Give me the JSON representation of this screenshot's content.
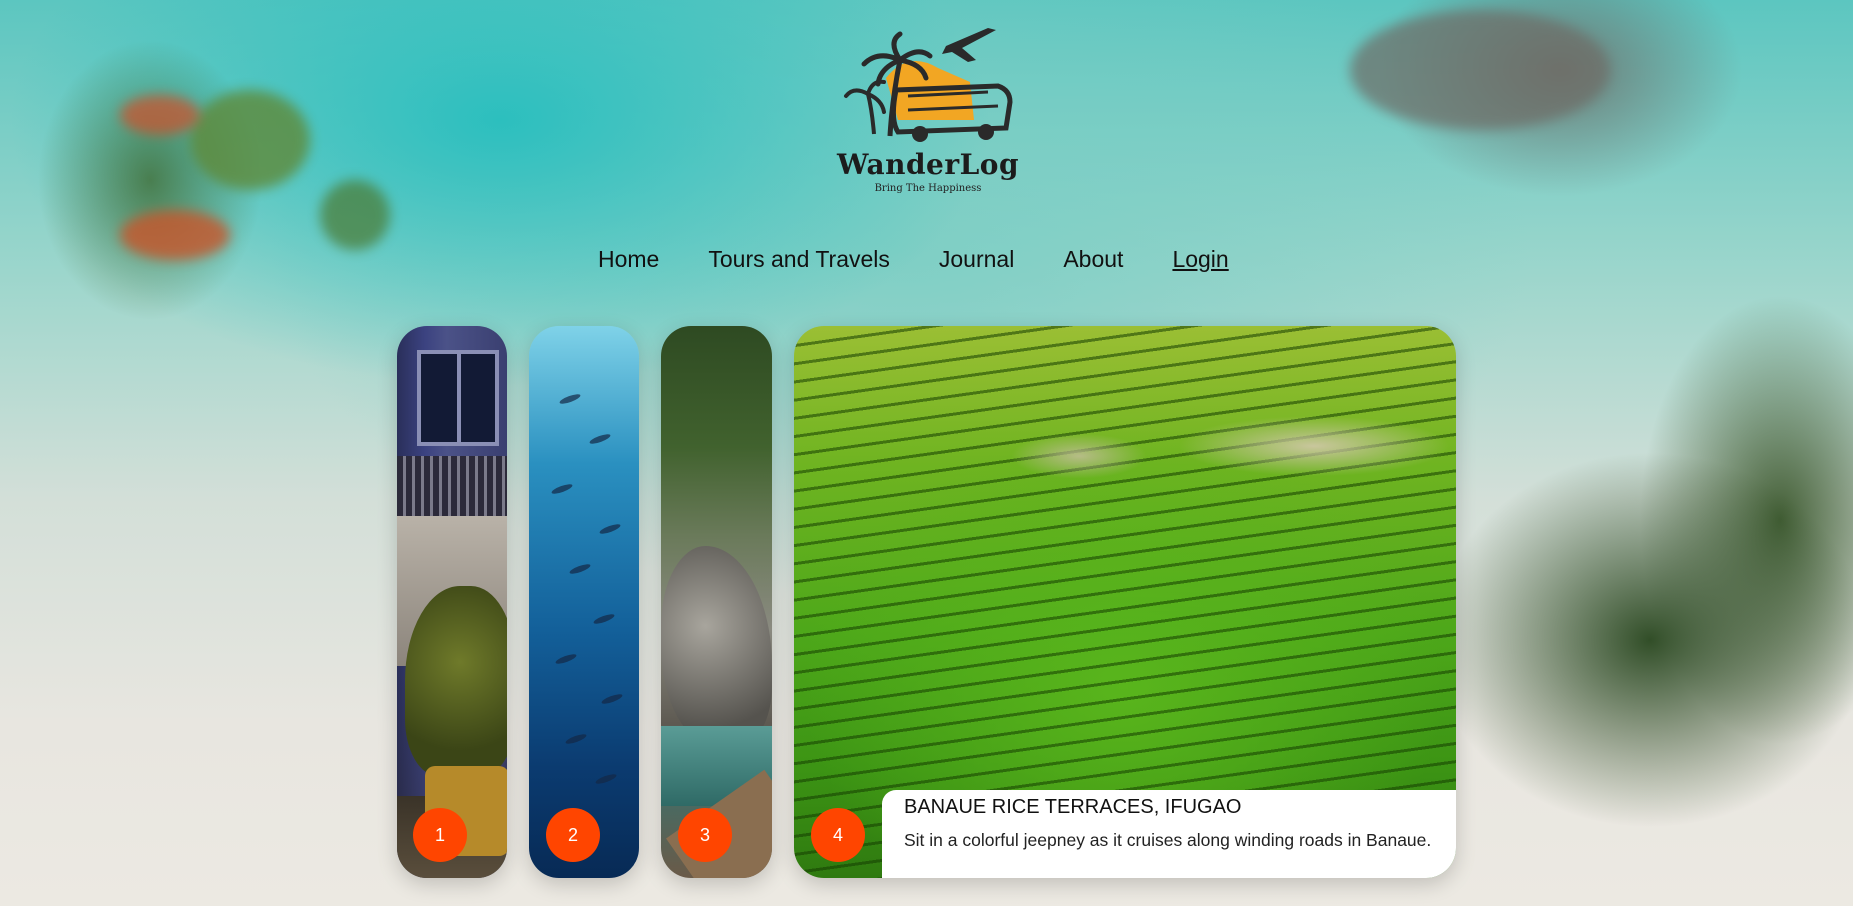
{
  "brand": {
    "name": "WanderLog",
    "tagline": "Bring The Happiness",
    "colors": {
      "accent": "#ff4500",
      "logo_orange": "#f2a623",
      "logo_dark": "#2a2a2a"
    }
  },
  "nav": {
    "items": [
      {
        "label": "Home"
      },
      {
        "label": "Tours and Travels"
      },
      {
        "label": "Journal"
      },
      {
        "label": "About"
      },
      {
        "label": "Login"
      }
    ]
  },
  "carousel": {
    "active_index": 4,
    "slides": [
      {
        "number": "1",
        "scene": "building-facade"
      },
      {
        "number": "2",
        "scene": "underwater-fish"
      },
      {
        "number": "3",
        "scene": "cave-lagoon"
      },
      {
        "number": "4",
        "scene": "rice-terraces"
      }
    ],
    "active_caption": {
      "title": "BANAUE RICE TERRACES, IFUGAO",
      "description": "Sit in a colorful jeepney as it cruises along winding roads in Banaue."
    }
  }
}
